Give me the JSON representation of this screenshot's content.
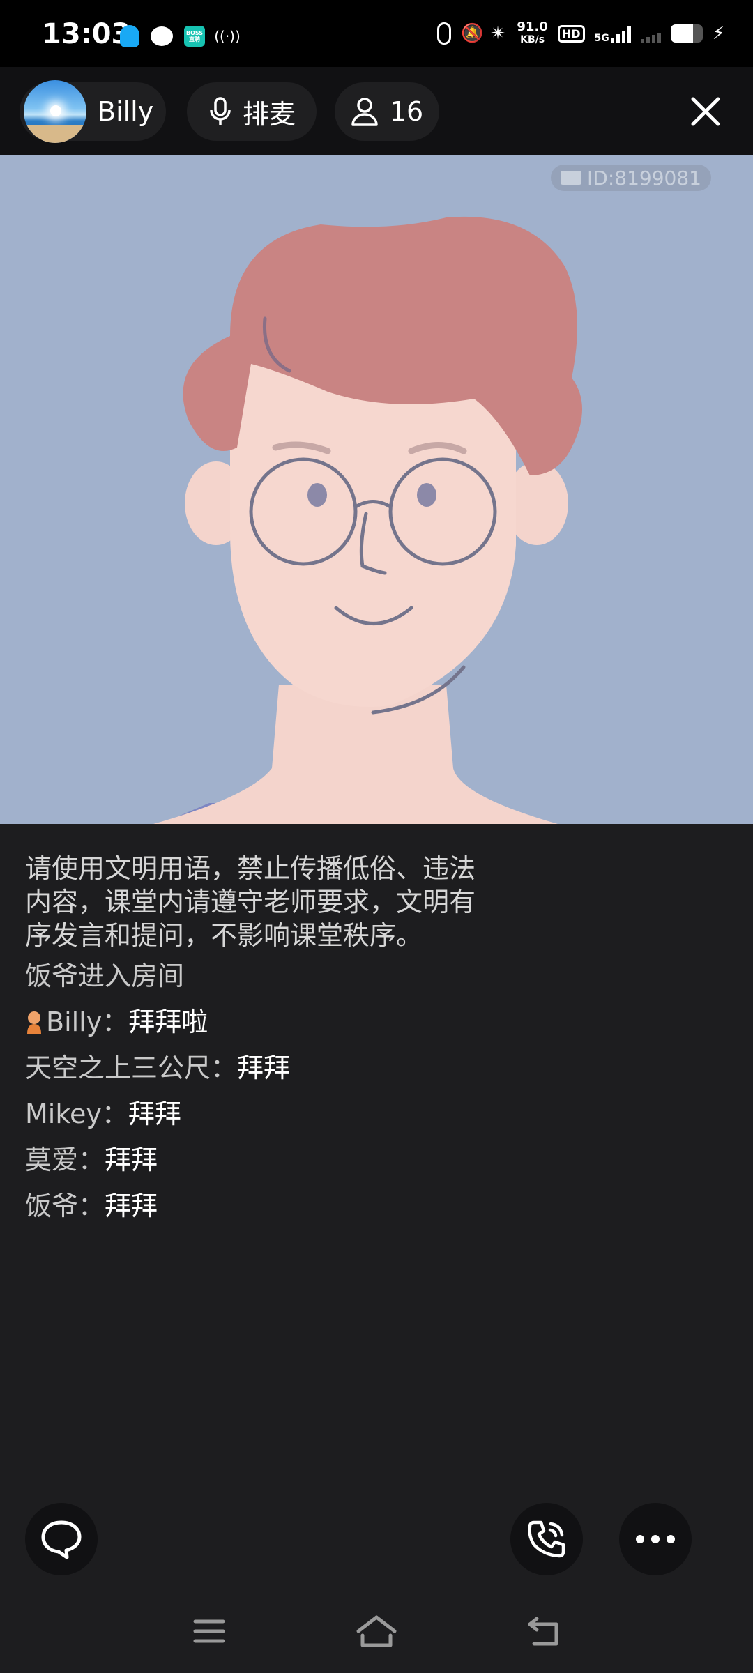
{
  "status_bar": {
    "time": "13:03",
    "net_speed_value": "91.0",
    "net_speed_unit": "KB/s",
    "hd_label": "HD",
    "network_label": "5G",
    "boss_label": "BOSS\n直聘",
    "battery_level": 0.7
  },
  "header": {
    "user_name": "Billy",
    "mic_queue_label": "排麦",
    "participant_count": "16"
  },
  "video": {
    "room_id": "ID:8199081"
  },
  "chat": {
    "notice": "请使用文明用语，禁止传播低俗、违法\n内容，课堂内请遵守老师要求，文明有\n序发言和提问，不影响课堂秩序。",
    "join_message": "饭爷进入房间",
    "messages": [
      {
        "user": "Billy：",
        "text": "拜拜啦"
      },
      {
        "user": "天空之上三公尺：",
        "text": "拜拜"
      },
      {
        "user": "Mikey：",
        "text": "拜拜"
      },
      {
        "user": "莫爱：",
        "text": "拜拜"
      },
      {
        "user": "饭爷：",
        "text": "拜拜"
      }
    ]
  },
  "icons": {
    "chat": "chat-bubble-icon",
    "call": "phone-call-icon",
    "more": "more-dots-icon",
    "close": "close-icon",
    "mic": "microphone-icon",
    "person": "person-icon"
  },
  "colors": {
    "background": "#1d1d1f",
    "video_bg": "#a1b1cc",
    "hair": "#c98483",
    "skin": "#f5d5cd"
  }
}
